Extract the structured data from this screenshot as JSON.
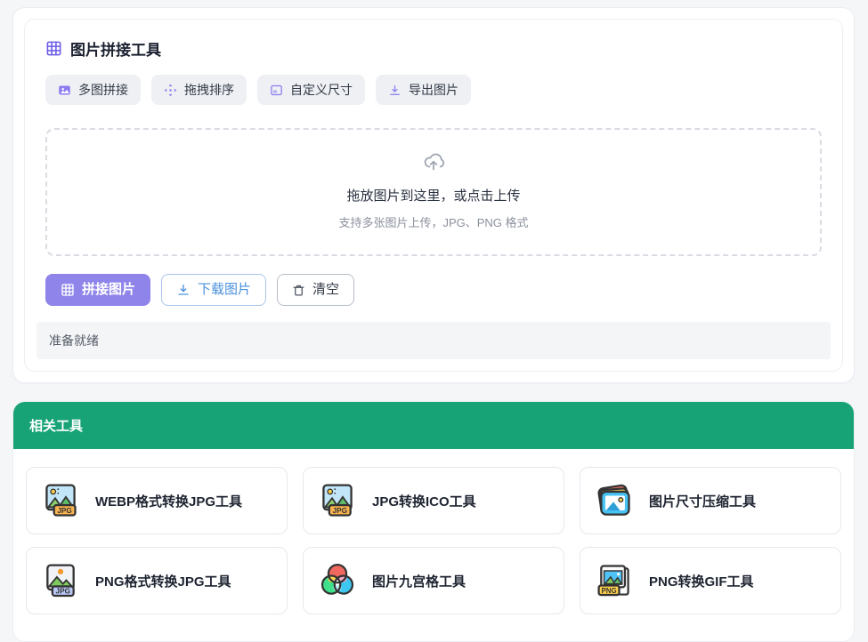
{
  "tool": {
    "title": "图片拼接工具",
    "features": [
      {
        "icon": "image-icon",
        "label": "多图拼接"
      },
      {
        "icon": "move-icon",
        "label": "拖拽排序"
      },
      {
        "icon": "resize-icon",
        "label": "自定义尺寸"
      },
      {
        "icon": "download-icon",
        "label": "导出图片"
      }
    ],
    "upload": {
      "icon": "cloud-upload-icon",
      "main_text": "拖放图片到这里，或点击上传",
      "sub_text": "支持多张图片上传，JPG、PNG 格式"
    },
    "actions": {
      "stitch_label": "拼接图片",
      "download_label": "下载图片",
      "clear_label": "清空"
    },
    "status_text": "准备就绪"
  },
  "related": {
    "header": "相关工具",
    "items": [
      {
        "icon": "jpg-photo-icon",
        "label": "WEBP格式转换JPG工具"
      },
      {
        "icon": "jpg-photo-icon",
        "label": "JPG转换ICO工具"
      },
      {
        "icon": "stacked-photos-icon",
        "label": "图片尺寸压缩工具"
      },
      {
        "icon": "png-to-jpg-icon",
        "label": "PNG格式转换JPG工具"
      },
      {
        "icon": "rgb-circles-icon",
        "label": "图片九宫格工具"
      },
      {
        "icon": "png-file-icon",
        "label": "PNG转换GIF工具"
      }
    ]
  },
  "colors": {
    "accent_purple": "#8e84ea",
    "icon_purple": "#7c6fe4",
    "link_blue": "#4a90dc",
    "header_green": "#17a376",
    "page_bg": "#f5f6f8"
  }
}
